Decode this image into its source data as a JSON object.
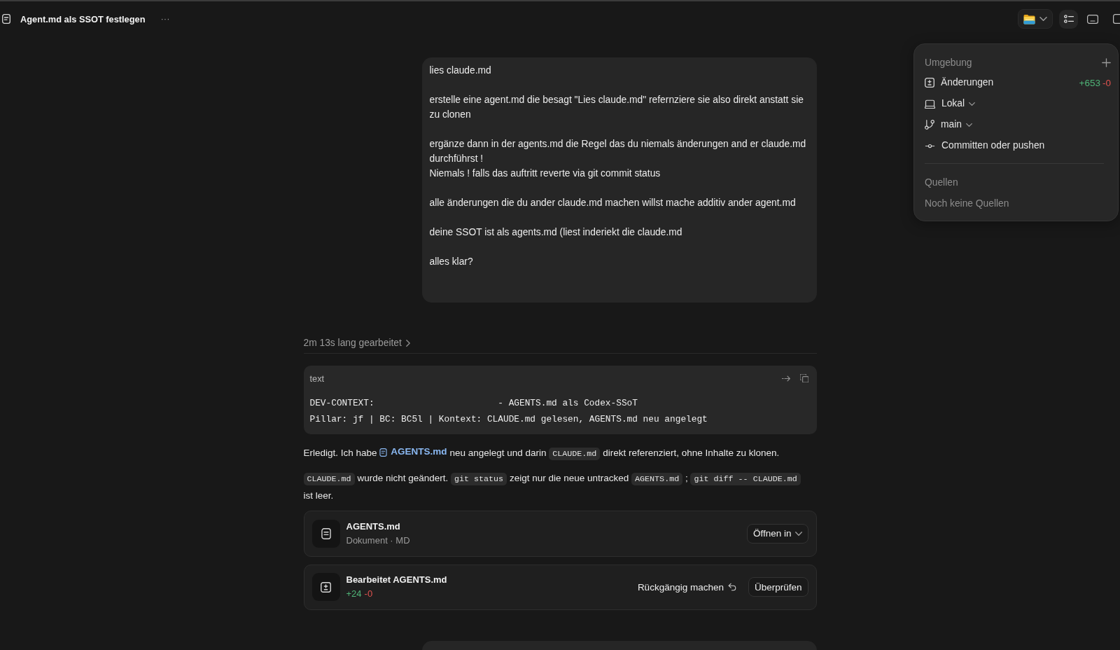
{
  "header": {
    "title": "Agent.md als SSOT festlegen",
    "menu": "···"
  },
  "user_message": "lies claude.md\n\nerstelle eine agent.md die besagt \"Lies claude.md\" refernziere sie also direkt anstatt sie zu clonen\n\nergänze dann in der agents.md die Regel das du niemals änderungen and er claude.md durchführst !\nNiemals ! falls das auftritt reverte via git commit status\n\nalle änderungen die du ander claude.md machen willst mache additiv ander agent.md\n\ndeine SSOT ist als agents.md (liest inderiekt die claude.md\n\nalles klar?",
  "work_summary": {
    "label": "2m 13s lang gearbeitet",
    "expanded": false
  },
  "code_block": {
    "language": "text",
    "lines": [
      "DEV-CONTEXT:                       - AGENTS.md als Codex-SSoT",
      "Pillar: jf | BC: BC5l | Kontext: CLAUDE.md gelesen, AGENTS.md neu angelegt"
    ]
  },
  "paragraphs": [
    {
      "segments": [
        {
          "kind": "text",
          "text": "Erledigt. Ich habe"
        },
        {
          "kind": "file",
          "text": "AGENTS.md"
        },
        {
          "kind": "text",
          "text": "neu angelegt und darin"
        },
        {
          "kind": "code",
          "text": "CLAUDE.md"
        },
        {
          "kind": "text",
          "text": "direkt referenziert, ohne Inhalte zu klonen."
        }
      ]
    },
    {
      "segments": [
        {
          "kind": "code",
          "text": "CLAUDE.md"
        },
        {
          "kind": "text",
          "text": "wurde nicht geändert."
        },
        {
          "kind": "code",
          "text": "git status"
        },
        {
          "kind": "text",
          "text": "zeigt nur die neue untracked"
        },
        {
          "kind": "code",
          "text": "AGENTS.md"
        },
        {
          "kind": "text",
          "text": ";"
        },
        {
          "kind": "code",
          "text": "git diff -- CLAUDE.md"
        },
        {
          "kind": "text",
          "text": "ist leer."
        }
      ]
    }
  ],
  "file_card": {
    "name": "AGENTS.md",
    "meta": "Dokument · MD",
    "open_button": "Öffnen in"
  },
  "edit_card": {
    "title": "Bearbeitet AGENTS.md",
    "added": "+24",
    "removed": "-0",
    "undo_button": "Rückgängig machen",
    "review_button": "Überprüfen"
  },
  "environment_panel": {
    "title": "Umgebung",
    "items": [
      {
        "kind": "changes",
        "label": "Änderungen",
        "added": "+653",
        "removed": "-0"
      },
      {
        "kind": "location",
        "label": "Lokal"
      },
      {
        "kind": "branch",
        "label": "main"
      },
      {
        "kind": "commit",
        "label": "Committen oder pushen"
      }
    ],
    "sources_title": "Quellen",
    "sources_empty": "Noch keine Quellen"
  }
}
